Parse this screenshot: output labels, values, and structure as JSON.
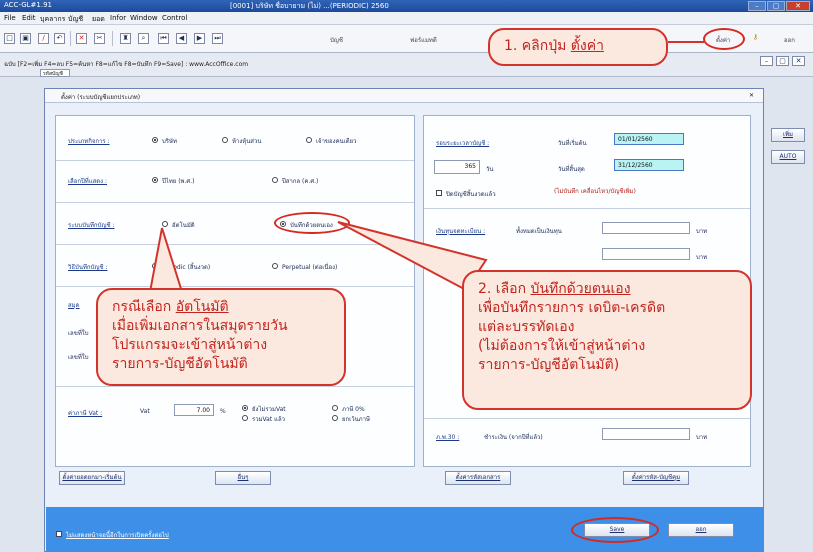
{
  "window": {
    "app_title": "ACC-GL#1.91",
    "doc_title": "[0001]  บริษัท ชื่อบายาม (ไม่) ...(PERIODIC) 2560",
    "controls": [
      "–",
      "▢",
      "✕"
    ]
  },
  "menu": [
    "File",
    "Edit",
    "บุคลากร",
    "บัญชี",
    "ยอด",
    "Infor",
    "Window",
    "Control"
  ],
  "toolbar": {
    "labels": [
      "บัญชี",
      "ฟอร์แมทดี",
      "ตั้งค่า",
      "ออก"
    ]
  },
  "appstrip": {
    "hint": "ฉบับ [F2=เพิ่ม F4=ลบ F5=ค้นหา F8=แก้ไข F8=บันทึก F9=Save] : www.AccOffice.com",
    "field_label": "รหัสบัญชี"
  },
  "dialog": {
    "title": "ตั้งค่า (ระบบบัญชีแยกประเภท)",
    "close": "✕",
    "sections": {
      "business_type": {
        "label": "ประเภทกิจการ :",
        "options": [
          "บริษัท",
          "ห้างหุ้นส่วน",
          "เจ้าของคนเดียว"
        ],
        "selected": 0
      },
      "fiscal_year": {
        "label": "เลือกปีที่แสดง :",
        "options": [
          "ปีไทย (พ.ศ.)",
          "ปีสากล (ค.ศ.)"
        ],
        "selected": 0
      },
      "record_system": {
        "label": "ระบบบันทึกบัญชี :",
        "options": [
          "อัตโนมัติ",
          "บันทึกด้วยตนเอง"
        ],
        "selected": 1
      },
      "inventory": {
        "label": "วิธีบันทึกบัญชี :",
        "options": [
          "Periodic (สิ้นงวด)",
          "Perpetual (ต่อเนื่อง)"
        ],
        "selected": -1
      },
      "journal_label": "สมุด",
      "doc_label_1": "เลขที่ใบ",
      "doc_label_2": "เลขที่ใบ",
      "vat": {
        "label": "ค่าภาษี Vat :",
        "prefix": "Vat",
        "value": "7.00",
        "unit": "%",
        "options": [
          "ยังไม่รวมVat",
          "รวมVat แล้ว",
          "ภาษี 0%",
          "ยกเว้นภาษี"
        ],
        "selected": 0
      }
    },
    "right": {
      "period_label": "รอบระยะเวลาบัญชี :",
      "start_label": "วันที่เริ่มต้น",
      "start_value": "01/01/2560",
      "end_label": "วันที่สิ้นสุด",
      "end_value": "31/12/2560",
      "days_value": "365",
      "days_unit": "วัน",
      "close_check": "ปิดบัญชีสิ้นงวดแล้ว",
      "close_note": "(ไม่บันทึก เคลื่อนไหว/บัญชีเพิ่ม)",
      "capital_label": "เงินทุนจดทะเบียน :",
      "capital_sub": "ทั้งหมดเป็นเงินทุน",
      "baht_1": "บาท",
      "baht_2": "บาท",
      "pnd_label": "ภ.พ.30 :",
      "pnd_sub": "ชำระเงิน (จากปีที่แล้ว)",
      "baht_3": "บาท"
    },
    "buttons": {
      "opening": "ตั้งค่ายอดยกมา-เริ่มต้น",
      "other": "อื่นๆ",
      "doc_format": "ตั้งค่ารหัสเอกสาร",
      "account": "ตั้งค่ารหัส-บัญชีคุม",
      "save": "Save",
      "exit": "ออก",
      "side_1": "เพิ่ม",
      "side_2": "AUTO"
    },
    "bottom_check": "ไม่แสดงหน้าจอนี้อีกในการเปิดครั้งต่อไป"
  },
  "callouts": {
    "c1_prefix": "1. คลิกปุ่ม ",
    "c1_emph": "ตั้งค่า",
    "c2_prefix": "2. เลือก ",
    "c2_emph": "บันทึกด้วยตนเอง",
    "c2_lines": [
      "เพื่อบันทึกรายการ เดบิต-เครดิต",
      "แต่ละบรรทัดเอง",
      "(ไม่ต้องการให้เข้าสู่หน้าต่าง",
      "รายการ-บัญชีอัตโนมัติ)"
    ],
    "c3_prefix": "กรณีเลือก ",
    "c3_emph": "อัตโนมัติ",
    "c3_lines": [
      "เมื่อเพิ่มเอกสารในสมุดรายวัน",
      "โปรแกรมจะเข้าสู่หน้าต่าง",
      "รายการ-บัญชีอัตโนมัติ"
    ]
  },
  "colors": {
    "accent_red": "#d2342b",
    "callout_bg": "#fbe9df",
    "bottom_blue": "#3d8fe8",
    "date_field": "#b9f3f3"
  }
}
